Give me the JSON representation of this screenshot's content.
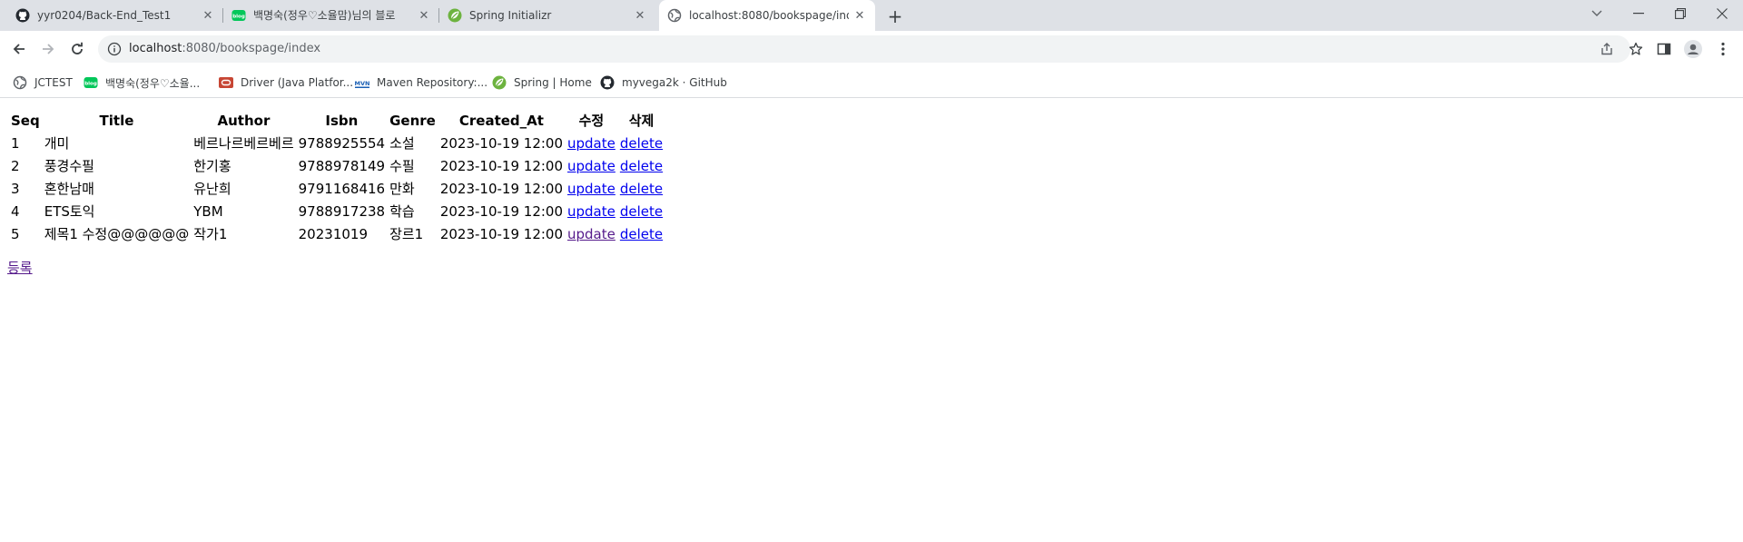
{
  "browser": {
    "tabs": [
      {
        "title": "yyr0204/Back-End_Test1",
        "icon": "github-icon",
        "active": false
      },
      {
        "title": "백명숙(정우♡소율맘)님의 블로",
        "icon": "naver-blog-icon",
        "active": false
      },
      {
        "title": "Spring Initializr",
        "icon": "spring-icon",
        "active": false
      },
      {
        "title": "localhost:8080/bookspage/inde",
        "icon": "globe-icon",
        "active": true
      }
    ],
    "new_tab_label": "+",
    "url_host": "localhost",
    "url_rest": ":8080/bookspage/index",
    "bookmarks": [
      {
        "label": "JCTEST",
        "icon": "globe-icon"
      },
      {
        "label": "백명숙(정우♡소율...",
        "icon": "naver-blog-icon"
      },
      {
        "label": "Driver (Java Platfor...",
        "icon": "oracle-icon"
      },
      {
        "label": "Maven Repository:...",
        "icon": "maven-icon"
      },
      {
        "label": "Spring | Home",
        "icon": "spring-icon"
      },
      {
        "label": "myvega2k · GitHub",
        "icon": "github-icon"
      }
    ],
    "colors": {
      "tabstrip": "#dee1e6",
      "omnibox": "#f1f3f4",
      "link": "#0000ee",
      "visited": "#551a8b"
    }
  },
  "page": {
    "headers": [
      "Seq",
      "Title",
      "Author",
      "Isbn",
      "Genre",
      "Created_At",
      "수정",
      "삭제"
    ],
    "rows": [
      {
        "seq": "1",
        "title": "개미",
        "author": "베르나르베르베르",
        "isbn": "9788925554",
        "genre": "소설",
        "created_at": "2023-10-19 12:00",
        "update": "update",
        "delete": "delete"
      },
      {
        "seq": "2",
        "title": "풍경수필",
        "author": "한기홍",
        "isbn": "9788978149",
        "genre": "수필",
        "created_at": "2023-10-19 12:00",
        "update": "update",
        "delete": "delete"
      },
      {
        "seq": "3",
        "title": "혼한남매",
        "author": "유난희",
        "isbn": "9791168416",
        "genre": "만화",
        "created_at": "2023-10-19 12:00",
        "update": "update",
        "delete": "delete"
      },
      {
        "seq": "4",
        "title": "ETS토익",
        "author": "YBM",
        "isbn": "9788917238",
        "genre": "학습",
        "created_at": "2023-10-19 12:00",
        "update": "update",
        "delete": "delete"
      },
      {
        "seq": "5",
        "title": "제목1 수정@@@@@@",
        "author": "작가1",
        "isbn": "20231019",
        "genre": "장르1",
        "created_at": "2023-10-19 12:00",
        "update": "update",
        "delete": "delete"
      }
    ],
    "register_label": "등록"
  }
}
